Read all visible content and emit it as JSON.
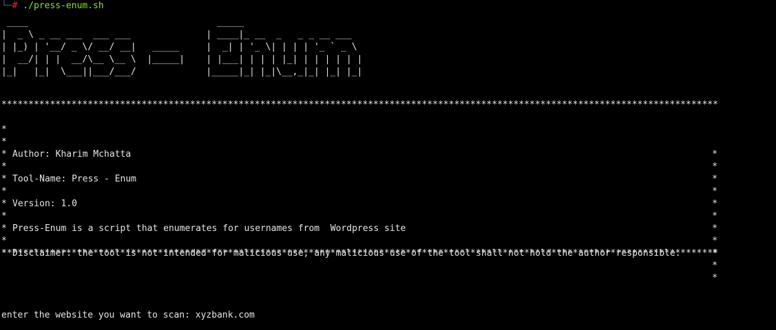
{
  "prompt": {
    "corner": "└─",
    "hash": "#",
    "command": " ./press-enum.sh"
  },
  "banner": {
    "ascii": " ____                                   _____                        \n|  _ \\ _ __ ___  ___ ___              | ____|_ __  _   _ _ __ ___    \n| |_) | '__/ _ \\/ __/ __|   _____     |  _| | '_ \\| | | | '_ ` _ \\   \n|  __/| | |  __/\\__ \\__ \\  |_____|    | |___| | | | |_| | | | | | |  \n|_|   |_|  \\___||___/___/             |_____|_| |_|\\__,_|_| |_| |_|  "
  },
  "info": {
    "border": "***********************************************************************************************************************************************",
    "lines": [
      "",
      "Author: Kharim Mchatta",
      "",
      "Tool-Name: Press - Enum",
      "",
      "Version: 1.0",
      "",
      "Press-Enum is a script that enumerates for usernames from  Wordpress site",
      "",
      "Disclaimer: the tool is not intended for malicious use, any malicious use of the tool shall not hold the author responsible.",
      ""
    ],
    "star": "*"
  },
  "scan": {
    "prompt_text": "enter the website you want to scan: ",
    "value": "xyzbank.com"
  }
}
